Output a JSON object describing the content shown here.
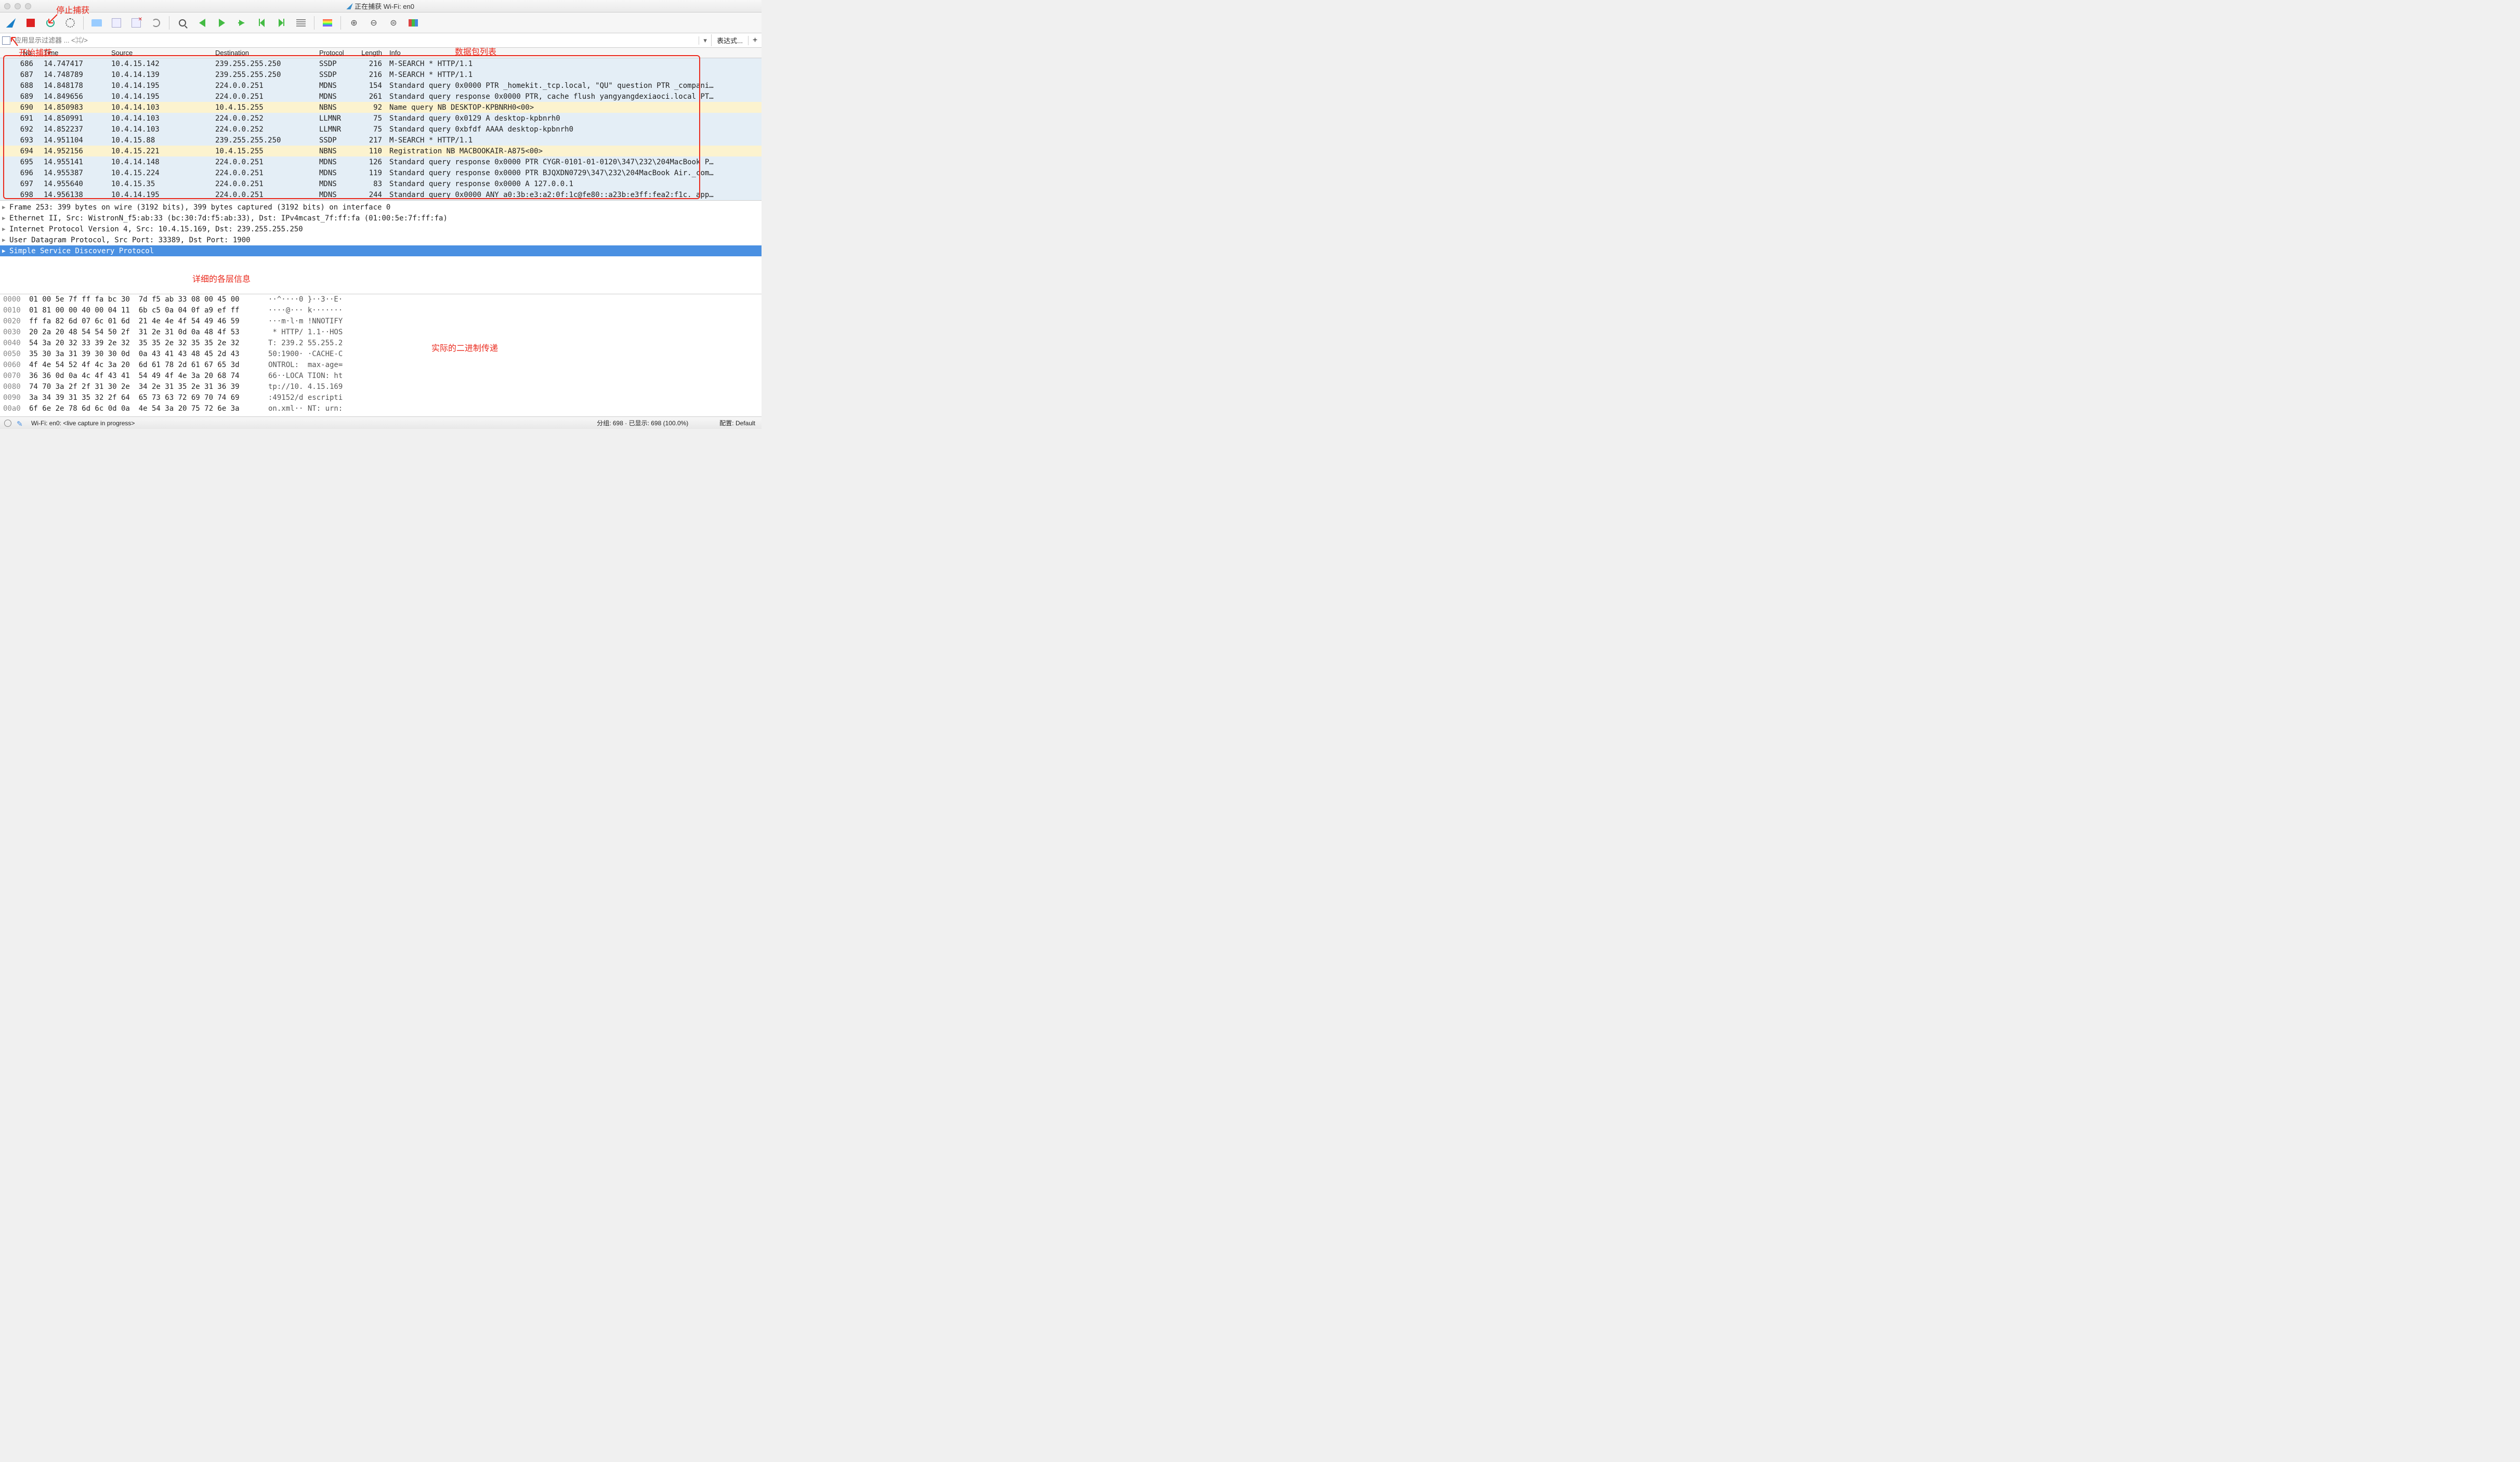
{
  "window": {
    "title": "正在捕获 Wi-Fi: en0"
  },
  "annotations": {
    "stop_capture": "停止捕获",
    "start_capture": "开始捕获",
    "packet_list": "数据包列表",
    "detail_layers": "详细的各层信息",
    "binary_transfer": "实际的二进制传递"
  },
  "filter": {
    "placeholder": "应用显示过滤器 ... <⌘/>",
    "expression_btn": "表达式...",
    "plus": "+"
  },
  "columns": {
    "no": "No.",
    "time": "Time",
    "source": "Source",
    "destination": "Destination",
    "protocol": "Protocol",
    "length": "Length",
    "info": "Info"
  },
  "packets": [
    {
      "no": "686",
      "time": "14.747417",
      "src": "10.4.15.142",
      "dst": "239.255.255.250",
      "proto": "SSDP",
      "len": "216",
      "info": "M-SEARCH * HTTP/1.1",
      "cls": "bg-blue"
    },
    {
      "no": "687",
      "time": "14.748789",
      "src": "10.4.14.139",
      "dst": "239.255.255.250",
      "proto": "SSDP",
      "len": "216",
      "info": "M-SEARCH * HTTP/1.1",
      "cls": "bg-blue"
    },
    {
      "no": "688",
      "time": "14.848178",
      "src": "10.4.14.195",
      "dst": "224.0.0.251",
      "proto": "MDNS",
      "len": "154",
      "info": "Standard query 0x0000 PTR _homekit._tcp.local, \"QU\" question PTR _compani…",
      "cls": "bg-blue"
    },
    {
      "no": "689",
      "time": "14.849656",
      "src": "10.4.14.195",
      "dst": "224.0.0.251",
      "proto": "MDNS",
      "len": "261",
      "info": "Standard query response 0x0000 PTR, cache flush yangyangdexiaoci.local PT…",
      "cls": "bg-blue"
    },
    {
      "no": "690",
      "time": "14.850983",
      "src": "10.4.14.103",
      "dst": "10.4.15.255",
      "proto": "NBNS",
      "len": "92",
      "info": "Name query NB DESKTOP-KPBNRH0<00>",
      "cls": "bg-yellow"
    },
    {
      "no": "691",
      "time": "14.850991",
      "src": "10.4.14.103",
      "dst": "224.0.0.252",
      "proto": "LLMNR",
      "len": "75",
      "info": "Standard query 0x0129 A desktop-kpbnrh0",
      "cls": "bg-blue"
    },
    {
      "no": "692",
      "time": "14.852237",
      "src": "10.4.14.103",
      "dst": "224.0.0.252",
      "proto": "LLMNR",
      "len": "75",
      "info": "Standard query 0xbfdf AAAA desktop-kpbnrh0",
      "cls": "bg-blue"
    },
    {
      "no": "693",
      "time": "14.951104",
      "src": "10.4.15.88",
      "dst": "239.255.255.250",
      "proto": "SSDP",
      "len": "217",
      "info": "M-SEARCH * HTTP/1.1",
      "cls": "bg-blue"
    },
    {
      "no": "694",
      "time": "14.952156",
      "src": "10.4.15.221",
      "dst": "10.4.15.255",
      "proto": "NBNS",
      "len": "110",
      "info": "Registration NB MACBOOKAIR-A875<00>",
      "cls": "bg-yellow"
    },
    {
      "no": "695",
      "time": "14.955141",
      "src": "10.4.14.148",
      "dst": "224.0.0.251",
      "proto": "MDNS",
      "len": "126",
      "info": "Standard query response 0x0000 PTR CYGR-0101-01-0120\\347\\232\\204MacBook P…",
      "cls": "bg-blue"
    },
    {
      "no": "696",
      "time": "14.955387",
      "src": "10.4.15.224",
      "dst": "224.0.0.251",
      "proto": "MDNS",
      "len": "119",
      "info": "Standard query response 0x0000 PTR BJQXDN0729\\347\\232\\204MacBook Air._com…",
      "cls": "bg-blue"
    },
    {
      "no": "697",
      "time": "14.955640",
      "src": "10.4.15.35",
      "dst": "224.0.0.251",
      "proto": "MDNS",
      "len": "83",
      "info": "Standard query response 0x0000 A 127.0.0.1",
      "cls": "bg-blue"
    },
    {
      "no": "698",
      "time": "14.956138",
      "src": "10.4.14.195",
      "dst": "224.0.0.251",
      "proto": "MDNS",
      "len": "244",
      "info": "Standard query 0x0000 ANY a0:3b:e3:a2:0f:1c@fe80::a23b:e3ff:fea2:f1c._app…",
      "cls": "bg-blue"
    }
  ],
  "details": [
    "Frame 253: 399 bytes on wire (3192 bits), 399 bytes captured (3192 bits) on interface 0",
    "Ethernet II, Src: WistronN_f5:ab:33 (bc:30:7d:f5:ab:33), Dst: IPv4mcast_7f:ff:fa (01:00:5e:7f:ff:fa)",
    "Internet Protocol Version 4, Src: 10.4.15.169, Dst: 239.255.255.250",
    "User Datagram Protocol, Src Port: 33389, Dst Port: 1900",
    "Simple Service Discovery Protocol"
  ],
  "hex": [
    {
      "off": "0000",
      "b": "01 00 5e 7f ff fa bc 30  7d f5 ab 33 08 00 45 00",
      "a": "··^····0 }··3··E·"
    },
    {
      "off": "0010",
      "b": "01 81 00 00 40 00 04 11  6b c5 0a 04 0f a9 ef ff",
      "a": "····@··· k·······"
    },
    {
      "off": "0020",
      "b": "ff fa 82 6d 07 6c 01 6d  21 4e 4e 4f 54 49 46 59",
      "a": "···m·l·m !NNOTIFY"
    },
    {
      "off": "0030",
      "b": "20 2a 20 48 54 54 50 2f  31 2e 31 0d 0a 48 4f 53",
      "a": " * HTTP/ 1.1··HOS"
    },
    {
      "off": "0040",
      "b": "54 3a 20 32 33 39 2e 32  35 35 2e 32 35 35 2e 32",
      "a": "T: 239.2 55.255.2"
    },
    {
      "off": "0050",
      "b": "35 30 3a 31 39 30 30 0d  0a 43 41 43 48 45 2d 43",
      "a": "50:1900· ·CACHE-C"
    },
    {
      "off": "0060",
      "b": "4f 4e 54 52 4f 4c 3a 20  6d 61 78 2d 61 67 65 3d",
      "a": "ONTROL:  max-age="
    },
    {
      "off": "0070",
      "b": "36 36 0d 0a 4c 4f 43 41  54 49 4f 4e 3a 20 68 74",
      "a": "66··LOCA TION: ht"
    },
    {
      "off": "0080",
      "b": "74 70 3a 2f 2f 31 30 2e  34 2e 31 35 2e 31 36 39",
      "a": "tp://10. 4.15.169"
    },
    {
      "off": "0090",
      "b": "3a 34 39 31 35 32 2f 64  65 73 63 72 69 70 74 69",
      "a": ":49152/d escripti"
    },
    {
      "off": "00a0",
      "b": "6f 6e 2e 78 6d 6c 0d 0a  4e 54 3a 20 75 72 6e 3a",
      "a": "on.xml·· NT: urn:"
    }
  ],
  "status": {
    "left": "Wi-Fi: en0: <live capture in progress>",
    "middle": "分组: 698 · 已显示: 698 (100.0%)",
    "right": "配置: Default"
  }
}
